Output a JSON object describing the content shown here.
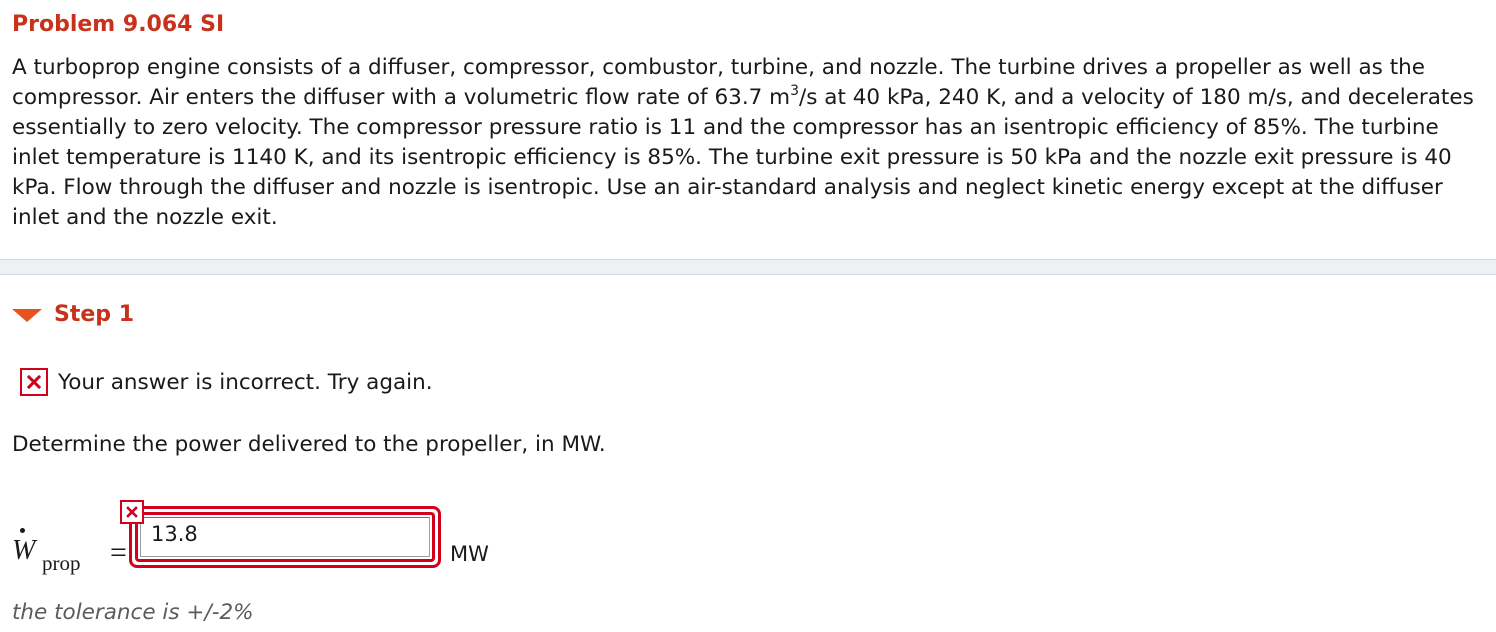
{
  "problem": {
    "title": "Problem 9.064 SI",
    "text_before_sup": "A turboprop engine consists of a diffuser, compressor, combustor, turbine, and nozzle. The turbine drives a propeller as well as the compressor. Air enters the diffuser with a volumetric flow rate of 63.7 m",
    "superscript": "3",
    "text_after_sup": "/s at 40 kPa, 240 K, and a velocity of 180 m/s, and decelerates essentially to zero velocity. The compressor pressure ratio is 11 and the compressor has an isentropic efficiency of 85%. The turbine inlet temperature is 1140 K, and its isentropic efficiency is 85%. The turbine exit pressure is 50 kPa and the nozzle exit pressure is 40 kPa. Flow through the diffuser and nozzle is isentropic. Use an air-standard analysis and neglect kinetic energy except at the diffuser inlet and the nozzle exit."
  },
  "step": {
    "label": "Step 1",
    "expanded": true,
    "toggle_icon": "triangle-down-icon"
  },
  "feedback": {
    "icon": "incorrect-x-icon",
    "text": "Your answer is incorrect.  Try again.",
    "status_color": "#d0021b"
  },
  "question": {
    "text": "Determine the power delivered to the propeller, in MW."
  },
  "equation": {
    "variable": "W",
    "subscript": "prop",
    "equals": "=",
    "input_value": "13.8",
    "unit": "MW",
    "input_status": "incorrect"
  },
  "tolerance": {
    "text": "the tolerance is +/-2%"
  },
  "colors": {
    "accent": "#c8321a",
    "toggle": "#e8521f",
    "error": "#d0021b"
  }
}
